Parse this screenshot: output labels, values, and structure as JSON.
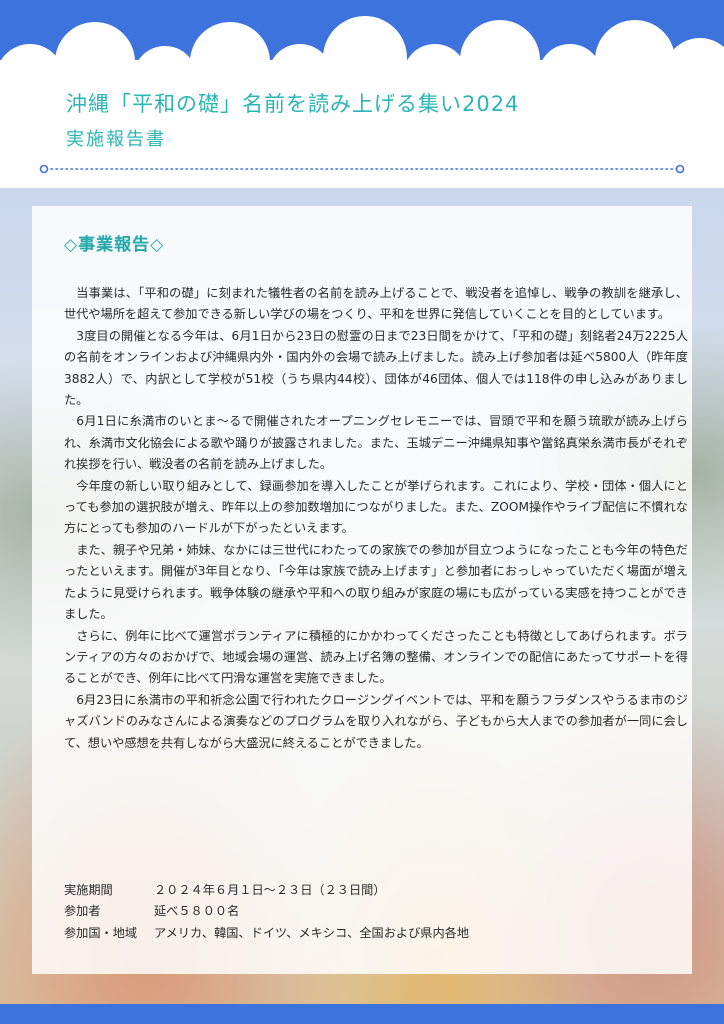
{
  "header": {
    "title": "沖縄「平和の礎」名前を読み上げる集い2024",
    "subtitle": "実施報告書"
  },
  "colors": {
    "band": "#3d73dc",
    "accent": "#2bb5b5",
    "text": "#2a2a2a"
  },
  "section": {
    "heading": "◇事業報告◇",
    "paragraphs": [
      "当事業は、「平和の礎」に刻まれた犠牲者の名前を読み上げることで、戦没者を追悼し、戦争の教訓を継承し、世代や場所を超えて参加できる新しい学びの場をつくり、平和を世界に発信していくことを目的としています。",
      "3度目の開催となる今年は、6月1日から23日の慰霊の日まで23日間をかけて、「平和の礎」刻銘者24万2225人の名前をオンラインおよび沖縄県内外・国内外の会場で読み上げました。読み上げ参加者は延べ5800人（昨年度3882人）で、内訳として学校が51校（うち県内44校）、団体が46団体、個人では118件の申し込みがありました。",
      "6月1日に糸満市のいとま～るで開催されたオープニングセレモニーでは、冒頭で平和を願う琉歌が読み上げられ、糸満市文化協会による歌や踊りが披露されました。また、玉城デニー沖縄県知事や當銘真栄糸満市長がそれぞれ挨拶を行い、戦没者の名前を読み上げました。",
      "今年度の新しい取り組みとして、録画参加を導入したことが挙げられます。これにより、学校・団体・個人にとっても参加の選択肢が増え、昨年以上の参加数増加につながりました。また、ZOOM操作やライブ配信に不慣れな方にとっても参加のハードルが下がったといえます。",
      "また、親子や兄弟・姉妹、なかには三世代にわたっての家族での参加が目立つようになったことも今年の特色だったといえます。開催が3年目となり、「今年は家族で読み上げます」と参加者におっしゃっていただく場面が増えたように見受けられます。戦争体験の継承や平和への取り組みが家庭の場にも広がっている実感を持つことができました。",
      "さらに、例年に比べて運営ボランティアに積極的にかかわってくださったことも特徴としてあげられます。ボランティアの方々のおかげで、地域会場の運営、読み上げ名簿の整備、オンラインでの配信にあたってサポートを得ることができ、例年に比べて円滑な運営を実施できました。",
      "6月23日に糸満市の平和祈念公園で行われたクロージングイベントでは、平和を願うフラダンスやうるま市のジャズバンドのみなさんによる演奏などのプログラムを取り入れながら、子どもから大人までの参加者が一同に会して、想いや感想を共有しながら大盛況に終えることができました。"
    ]
  },
  "info": [
    {
      "label": "実施期間",
      "value": "２０２４年６月１日～２３日（２３日間）"
    },
    {
      "label": "参加者",
      "value": "延べ５８００名"
    },
    {
      "label": "参加国・地域",
      "value": "アメリカ、韓国、ドイツ、メキシコ、全国および県内各地"
    }
  ]
}
